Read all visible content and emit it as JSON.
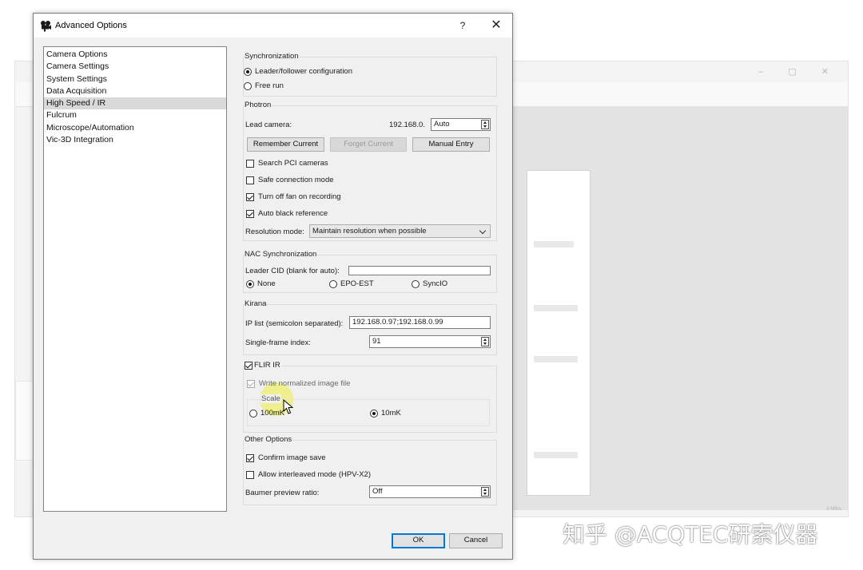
{
  "dialog": {
    "title": "Advanced Options",
    "help_label": "?",
    "close_label": "✕"
  },
  "nav": {
    "items": [
      {
        "label": "Camera Options",
        "selected": false
      },
      {
        "label": "Camera Settings",
        "selected": false
      },
      {
        "label": "System Settings",
        "selected": false
      },
      {
        "label": "Data Acquisition",
        "selected": false
      },
      {
        "label": "High Speed / IR",
        "selected": true
      },
      {
        "label": "Fulcrum",
        "selected": false
      },
      {
        "label": "Microscope/Automation",
        "selected": false
      },
      {
        "label": "Vic-3D Integration",
        "selected": false
      }
    ]
  },
  "sync": {
    "title": "Synchronization",
    "options": [
      {
        "label": "Leader/follower configuration",
        "checked": true
      },
      {
        "label": "Free run",
        "checked": false
      }
    ]
  },
  "photron": {
    "title": "Photron",
    "lead_camera_label": "Lead camera:",
    "ip_prefix": "192.168.0.",
    "lead_camera_value": "Auto",
    "remember_label": "Remember Current",
    "forget_label": "Forget Current",
    "manual_label": "Manual Entry",
    "checkboxes": [
      {
        "label": "Search PCI cameras",
        "checked": false
      },
      {
        "label": "Safe connection mode",
        "checked": false
      },
      {
        "label": "Turn off fan on recording",
        "checked": true
      },
      {
        "label": "Auto black reference",
        "checked": true
      }
    ],
    "resolution_label": "Resolution mode:",
    "resolution_value": "Maintain resolution when possible"
  },
  "nac": {
    "title": "NAC Synchronization",
    "leader_cid_label": "Leader CID (blank for auto):",
    "leader_cid_value": "",
    "options": [
      {
        "label": "None",
        "checked": true
      },
      {
        "label": "EPO-EST",
        "checked": false
      },
      {
        "label": "SyncIO",
        "checked": false
      }
    ]
  },
  "kirana": {
    "title": "Kirana",
    "ip_label": "IP list (semicolon separated):",
    "ip_value": "192.168.0.97;192.168.0.99",
    "frame_label": "Single-frame index:",
    "frame_value": "91"
  },
  "flir": {
    "title": "FLIR IR",
    "enabled": true,
    "write_label": "Write normalized image file",
    "write_checked": true,
    "scale_title": "Scale",
    "scale_options": [
      {
        "label": "100mK",
        "checked": false
      },
      {
        "label": "10mK",
        "checked": true
      }
    ]
  },
  "other": {
    "title": "Other Options",
    "checkboxes": [
      {
        "label": "Confirm image save",
        "checked": true
      },
      {
        "label": "Allow interleaved mode (HPV-X2)",
        "checked": false
      }
    ],
    "baumer_label": "Baumer preview ratio:",
    "baumer_value": "Off"
  },
  "footer": {
    "ok_label": "OK",
    "cancel_label": "Cancel"
  },
  "background": {
    "window_controls": "–  ▢  ✕",
    "status_text": "0 MB/s"
  },
  "watermark": {
    "text": "知乎 @ACQTEC研索仪器"
  },
  "colors": {
    "dialog_bg": "#f0f0f0",
    "selection": "#d9d9d9",
    "default_button_border": "#0078d7",
    "highlight": "#eeee3c"
  }
}
